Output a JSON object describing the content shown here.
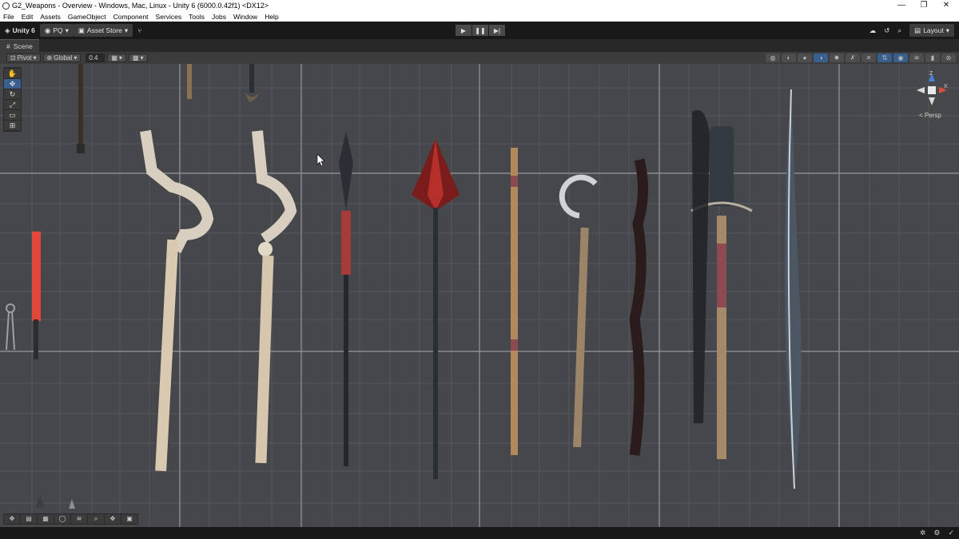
{
  "window": {
    "title": "G2_Weapons - Overview - Windows, Mac, Linux - Unity 6 (6000.0.42f1) <DX12>",
    "minimize": "—",
    "maximize": "❐",
    "close": "✕"
  },
  "menu": [
    "File",
    "Edit",
    "Assets",
    "GameObject",
    "Component",
    "Services",
    "Tools",
    "Jobs",
    "Window",
    "Help"
  ],
  "toolbar": {
    "unity_label": "Unity 6",
    "account_label": "PQ",
    "asset_store_label": "Asset Store",
    "layout_label": "Layout"
  },
  "scene_tab": {
    "label": "Scene"
  },
  "scene_toolbar": {
    "pivot_label": "Pivot",
    "global_label": "Global",
    "snap_value": "0.4"
  },
  "gizmo": {
    "z_label": "Z",
    "x_label": "X",
    "projection_label": "< Persp"
  }
}
